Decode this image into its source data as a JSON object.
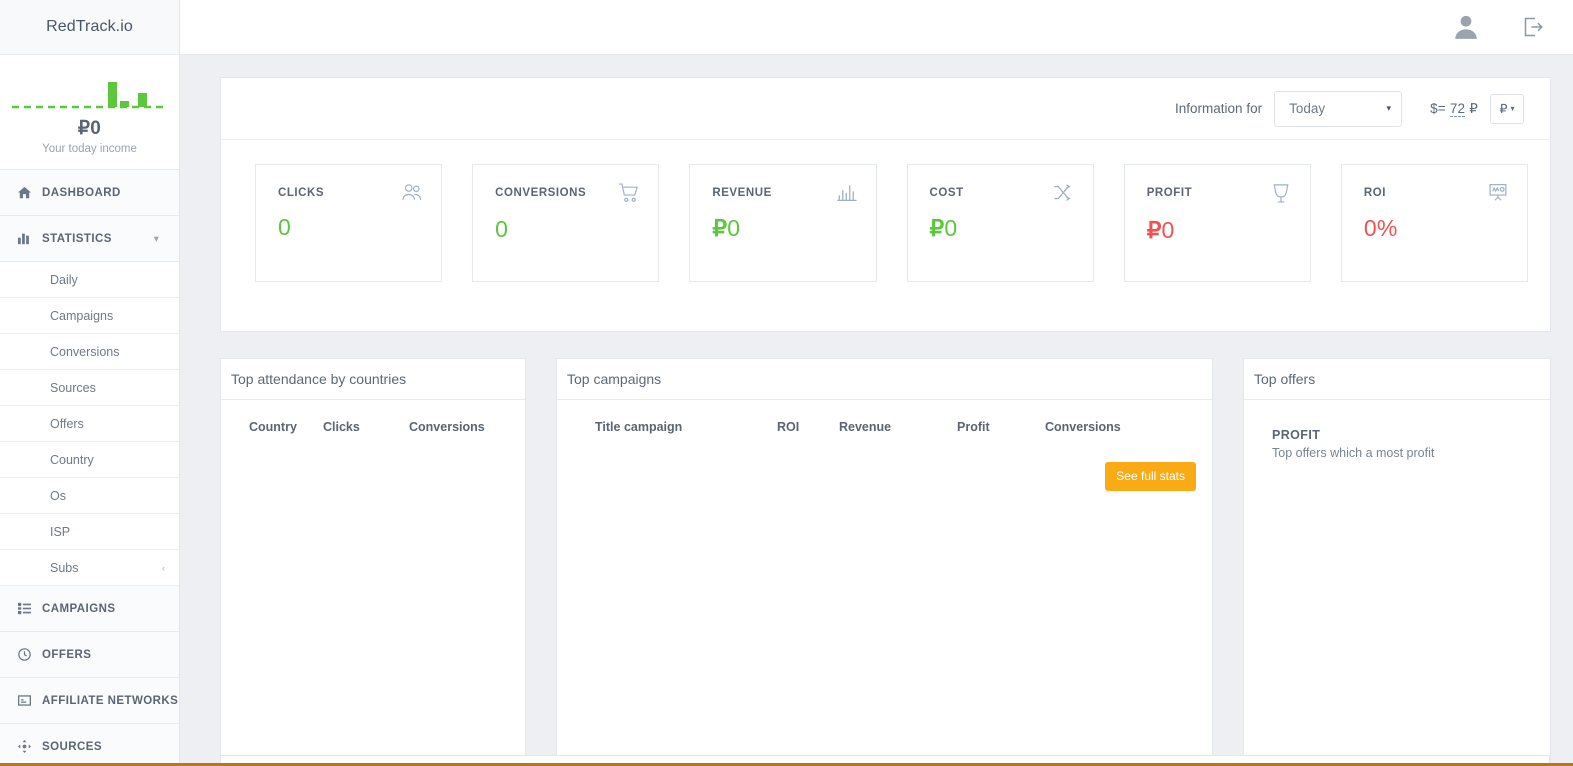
{
  "brand": {
    "name": "RedTrack.io"
  },
  "sidebar": {
    "income": {
      "amount": "₽0",
      "label": "Your today income",
      "sparkline": [
        0,
        0,
        0,
        0,
        0,
        0,
        0,
        0,
        0,
        0,
        0,
        28,
        6,
        0,
        16,
        0,
        0,
        0,
        0
      ]
    },
    "items": [
      {
        "label": "DASHBOARD",
        "icon": "home-icon",
        "key": "dashboard"
      },
      {
        "label": "STATISTICS",
        "icon": "bar-chart-icon",
        "key": "statistics",
        "expanded": true,
        "caret": "▾"
      },
      {
        "label": "CAMPAIGNS",
        "icon": "list-icon",
        "key": "campaigns"
      },
      {
        "label": "OFFERS",
        "icon": "clock-icon",
        "key": "offers"
      },
      {
        "label": "AFFILIATE NETWORKS",
        "icon": "window-icon",
        "key": "affiliate-networks"
      },
      {
        "label": "SOURCES",
        "icon": "move-icon",
        "key": "sources"
      }
    ],
    "statistics_sub": [
      {
        "label": "Daily",
        "key": "daily"
      },
      {
        "label": "Campaigns",
        "key": "campaigns"
      },
      {
        "label": "Conversions",
        "key": "conversions"
      },
      {
        "label": "Sources",
        "key": "sources"
      },
      {
        "label": "Offers",
        "key": "offers"
      },
      {
        "label": "Country",
        "key": "country"
      },
      {
        "label": "Os",
        "key": "os"
      },
      {
        "label": "ISP",
        "key": "isp"
      },
      {
        "label": "Subs",
        "key": "subs",
        "caret": "‹"
      }
    ]
  },
  "topbar": {
    "avatar_icon": "user-avatar-icon",
    "logout_icon": "logout-icon"
  },
  "info": {
    "label": "Information for",
    "period_selected": "Today",
    "period_arrow": "▾",
    "rate_prefix": "$=",
    "rate_value": "72",
    "rate_suffix": "₽",
    "currency_symbol": "₽",
    "currency_arrow": "▾"
  },
  "kpis": [
    {
      "title": "CLICKS",
      "value": "0",
      "currency": "",
      "color": "green",
      "icon": "users-icon"
    },
    {
      "title": "CONVERSIONS",
      "value": "0",
      "currency": "",
      "color": "green",
      "icon": "cart-icon"
    },
    {
      "title": "REVENUE",
      "value": "0",
      "currency": "₽",
      "color": "green",
      "icon": "bar-chart-icon"
    },
    {
      "title": "COST",
      "value": "0",
      "currency": "₽",
      "color": "green",
      "icon": "shuffle-icon"
    },
    {
      "title": "PROFIT",
      "value": "0",
      "currency": "₽",
      "color": "red",
      "icon": "trophy-icon"
    },
    {
      "title": "ROI",
      "value": "0%",
      "currency": "",
      "color": "red",
      "icon": "presentation-icon"
    }
  ],
  "countries_panel": {
    "title": "Top attendance by countries",
    "columns": [
      "Country",
      "Clicks",
      "Conversions"
    ],
    "rows": []
  },
  "campaigns_panel": {
    "title": "Top campaigns",
    "columns": [
      "Title campaign",
      "ROI",
      "Revenue",
      "Profit",
      "Conversions"
    ],
    "rows": [],
    "button_label": "See full stats"
  },
  "offers_panel": {
    "title": "Top offers",
    "metric": "PROFIT",
    "description": "Top offers which a most profit"
  },
  "colors": {
    "brand_green": "#5cc63d",
    "danger_red": "#ef5350",
    "accent_amber": "#f9ab16",
    "page_bg": "#edeff2",
    "sidebar_bg": "#fafbfc"
  }
}
